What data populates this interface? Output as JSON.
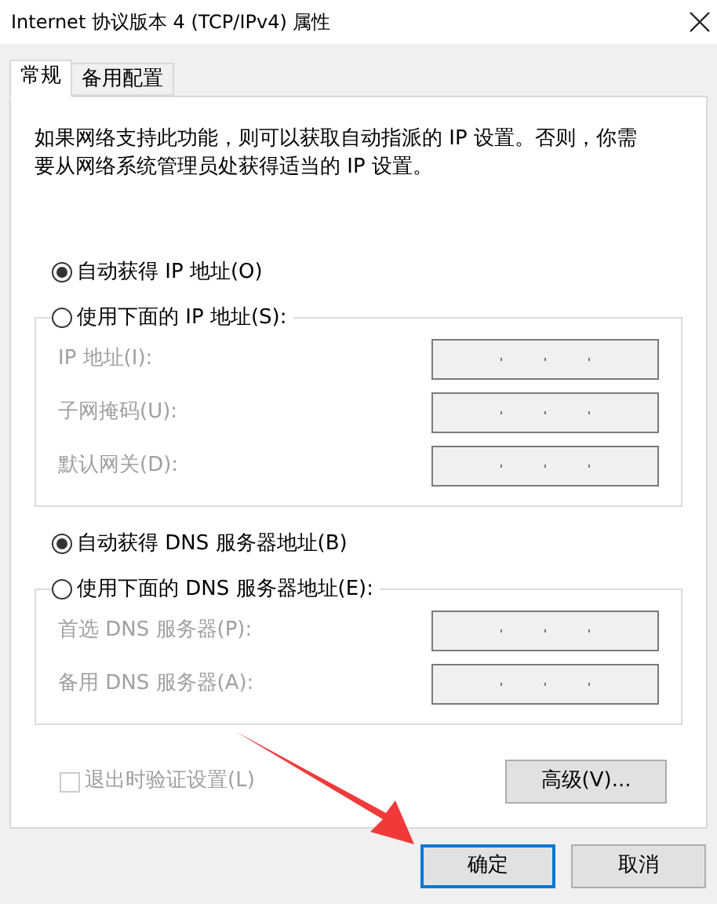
{
  "window": {
    "title": "Internet 协议版本 4 (TCP/IPv4) 属性"
  },
  "tabs": [
    {
      "label": "常规",
      "selected": true
    },
    {
      "label": "备用配置",
      "selected": false
    }
  ],
  "description": "如果网络支持此功能，则可以获取自动指派的 IP 设置。否则，你需要从网络系统管理员处获得适当的 IP 设置。",
  "sections": [
    {
      "auto_option": {
        "label": "自动获得 IP 地址(O)",
        "selected": true
      },
      "manual_option": {
        "label": "使用下面的 IP 地址(S):",
        "selected": false
      },
      "fields": [
        {
          "label": "IP 地址(I):",
          "disabled": true
        },
        {
          "label": "子网掩码(U):",
          "disabled": true
        },
        {
          "label": "默认网关(D):",
          "disabled": true
        }
      ]
    },
    {
      "auto_option": {
        "label": "自动获得 DNS 服务器地址(B)",
        "selected": true
      },
      "manual_option": {
        "label": "使用下面的 DNS 服务器地址(E):",
        "selected": false
      },
      "fields": [
        {
          "label": "首选 DNS 服务器(P):",
          "disabled": true
        },
        {
          "label": "备用 DNS 服务器(A):",
          "disabled": true
        }
      ]
    }
  ],
  "validate_checkbox": {
    "label": "退出时验证设置(L)",
    "checked": false,
    "disabled": true
  },
  "advanced_button": {
    "label": "高级(V)..."
  },
  "buttons": [
    {
      "label": "确定",
      "default": true
    },
    {
      "label": "取消",
      "default": false
    }
  ]
}
